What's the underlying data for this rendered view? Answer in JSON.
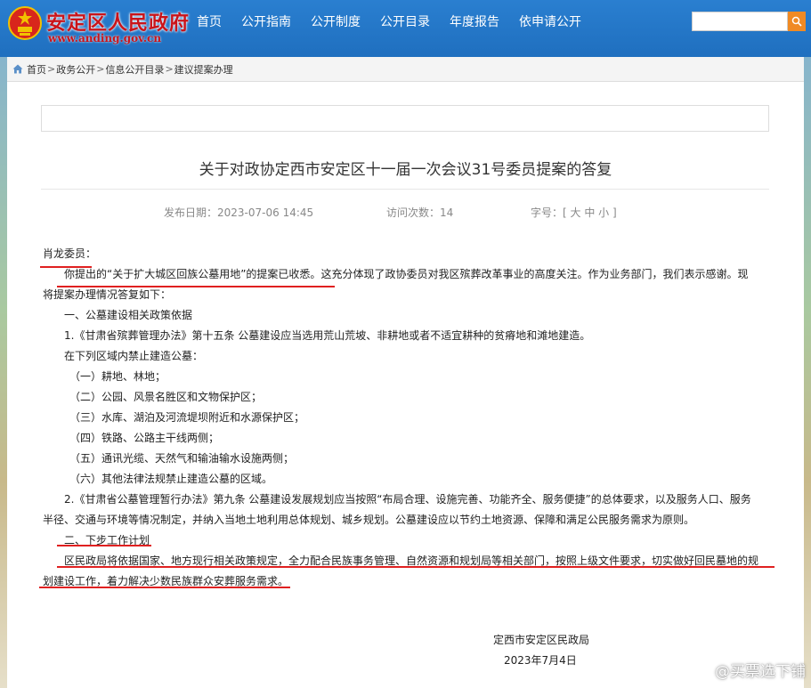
{
  "header": {
    "site_name": "安定区人民政府",
    "site_url": "www.anding.gov.cn",
    "nav": [
      "首页",
      "公开指南",
      "公开制度",
      "公开目录",
      "年度报告",
      "依申请公开"
    ],
    "search_placeholder": ""
  },
  "breadcrumb": [
    "首页",
    "政务公开",
    "信息公开目录",
    "建议提案办理"
  ],
  "article": {
    "title": "关于对政协定西市安定区十一届一次会议31号委员提案的答复",
    "publish_label": "发布日期：",
    "publish_date": "2023-07-06 14:45",
    "visits_label": "访问次数：",
    "visits": "14",
    "font_label": "字号：",
    "font_sizes": "[ 大 中 小 ]",
    "salutation": "肖龙委员：",
    "para1_a": "你提出的“关于扩大城区回族公墓用地”的提案已收悉。",
    "para1_b": "这充分体现了政协委员对我区殡葬改革事业的高度关注。作为业务部门，我们表示感谢。现",
    "para1_c": "将提案办理情况答复如下：",
    "section1": "一、公墓建设相关政策依据",
    "item1": "1.《甘肃省殡葬管理办法》第十五条 公墓建设应当选用荒山荒坡、非耕地或者不适宜耕种的贫瘠地和滩地建造。",
    "item1_sub": "在下列区域内禁止建造公墓：",
    "prohibited": [
      "（一）耕地、林地；",
      "（二）公园、风景名胜区和文物保护区；",
      "（三）水库、湖泊及河流堤坝附近和水源保护区；",
      "（四）铁路、公路主干线两侧；",
      "（五）通讯光缆、天然气和输油输水设施两侧；",
      "（六）其他法律法规禁止建造公墓的区域。"
    ],
    "item2_a": "2.《甘肃省公墓管理暂行办法》第九条 公墓建设发展规划应当按照“布局合理、设施完善、功能齐全、服务便捷”的总体要求，以及服务人口、服务",
    "item2_b": "半径、交通与环境等情况制定，并纳入当地土地利用总体规划、城乡规划。公墓建设应以节约土地资源、保障和满足公民服务需求为原则。",
    "section2": "二、下步工作计划",
    "para3_a": "区民政局将依据国家、地方现行相关政策规定，全力配合民族事务管理、自然资源和规划局等相关部门，按照上级文件要求，切实做好回民墓地的规",
    "para3_b": "划建设工作，着力解决少数民族群众安葬服务需求。",
    "signature_org": "定西市安定区民政局",
    "signature_date": "2023年7月4日"
  },
  "watermark": "@买票选下铺",
  "colors": {
    "header_blue": "#1f6fbf",
    "brand_red": "#c9141a",
    "annotation_red": "#e02020",
    "search_orange": "#f08a24"
  }
}
